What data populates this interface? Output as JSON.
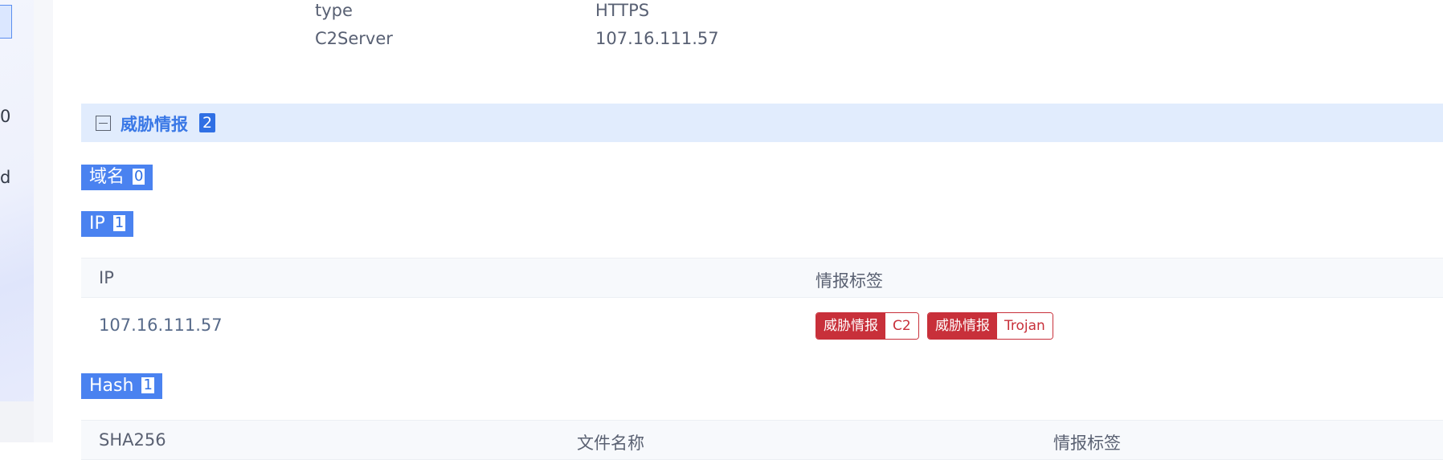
{
  "sidebar": {
    "items": [
      "0",
      "d"
    ]
  },
  "details": [
    {
      "key": "type",
      "value": "HTTPS"
    },
    {
      "key": "C2Server",
      "value": "107.16.111.57"
    }
  ],
  "threat_section": {
    "title": "威胁情报",
    "count": "2"
  },
  "domain_group": {
    "label": "域名",
    "count": "0"
  },
  "ip_group": {
    "label": "IP",
    "count": "1",
    "columns": [
      "IP",
      "情报标签"
    ],
    "rows": [
      {
        "ip": "107.16.111.57",
        "tags": [
          {
            "key": "威胁情报",
            "value": "C2"
          },
          {
            "key": "威胁情报",
            "value": "Trojan"
          }
        ]
      }
    ]
  },
  "hash_group": {
    "label": "Hash",
    "count": "1",
    "columns": [
      "SHA256",
      "文件名称",
      "情报标签"
    ]
  },
  "colors": {
    "accent": "#4a82f0",
    "section_bg": "#e1ecfd",
    "tag_red": "#c8303a"
  }
}
